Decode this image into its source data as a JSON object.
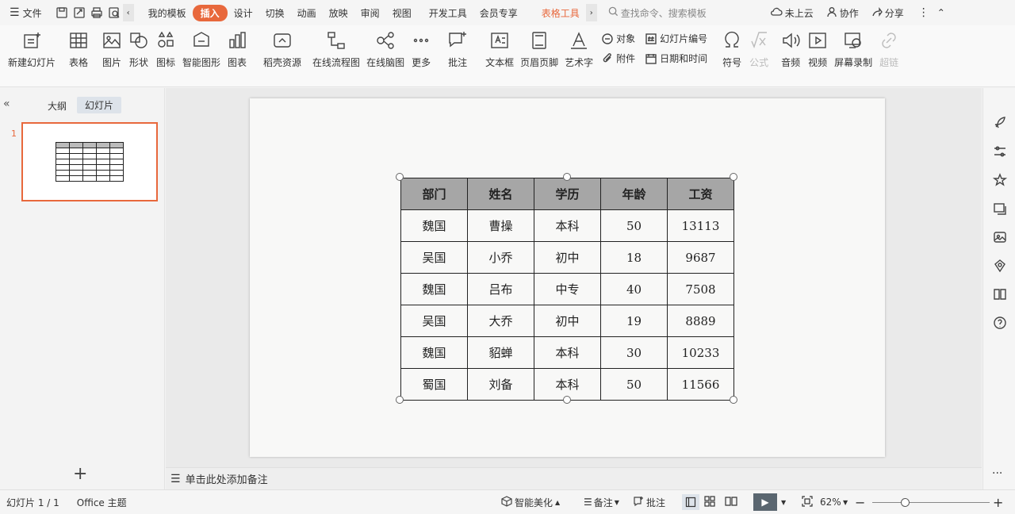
{
  "menubar": {
    "file": "文件",
    "tabs": [
      "我的模板",
      "插入",
      "设计",
      "切换",
      "动画",
      "放映",
      "审阅",
      "视图",
      "开发工具",
      "会员专享",
      "表格工具"
    ],
    "search_placeholder": "查找命令、搜索模板",
    "cloud": "未上云",
    "collab": "协作",
    "share": "分享"
  },
  "ribbon": {
    "items": [
      "新建幻灯片",
      "表格",
      "图片",
      "形状",
      "图标",
      "智能图形",
      "图表",
      "稻壳资源",
      "在线流程图",
      "在线脑图",
      "更多",
      "批注",
      "文本框",
      "页眉页脚",
      "艺术字"
    ],
    "obj": "对象",
    "slide_num": "幻灯片编号",
    "attach": "附件",
    "datetime": "日期和时间",
    "items2": [
      "符号",
      "公式",
      "音频",
      "视频",
      "屏幕录制",
      "超链"
    ]
  },
  "leftpane": {
    "tab_outline": "大纲",
    "tab_slides": "幻灯片",
    "slide_number": "1"
  },
  "table": {
    "headers": [
      "部门",
      "姓名",
      "学历",
      "年龄",
      "工资"
    ],
    "rows": [
      [
        "魏国",
        "曹操",
        "本科",
        "50",
        "13113"
      ],
      [
        "吴国",
        "小乔",
        "初中",
        "18",
        "9687"
      ],
      [
        "魏国",
        "吕布",
        "中专",
        "40",
        "7508"
      ],
      [
        "吴国",
        "大乔",
        "初中",
        "19",
        "8889"
      ],
      [
        "魏国",
        "貂蝉",
        "本科",
        "30",
        "10233"
      ],
      [
        "蜀国",
        "刘备",
        "本科",
        "50",
        "11566"
      ]
    ]
  },
  "notes_placeholder": "单击此处添加备注",
  "status": {
    "slide_info": "幻灯片 1 / 1",
    "theme": "Office 主题",
    "beautify": "智能美化",
    "notes": "备注",
    "comment": "批注",
    "zoom": "62%"
  },
  "colors": {
    "accent": "#e8683c",
    "header_fill": "#a6a6a6"
  }
}
